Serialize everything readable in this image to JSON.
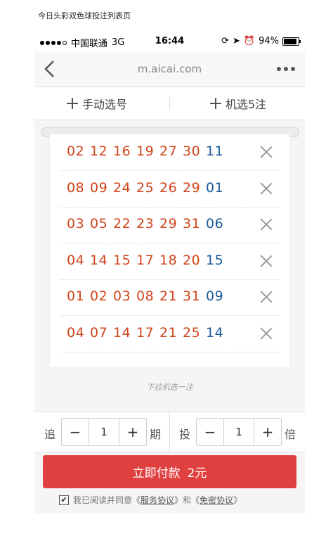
{
  "caption": "今日头彩双色球投注列表页",
  "statusbar": {
    "carrier": "中国联通",
    "network": "3G",
    "time": "16:44",
    "battery": "94%"
  },
  "navbar": {
    "url": "m.aicai.com"
  },
  "actions": {
    "manual": "手动选号",
    "random": "机选5注"
  },
  "tickets": [
    {
      "red": [
        "02",
        "12",
        "16",
        "19",
        "27",
        "30"
      ],
      "blue": "11"
    },
    {
      "red": [
        "08",
        "09",
        "24",
        "25",
        "26",
        "29"
      ],
      "blue": "01"
    },
    {
      "red": [
        "03",
        "05",
        "22",
        "23",
        "29",
        "31"
      ],
      "blue": "06"
    },
    {
      "red": [
        "04",
        "14",
        "15",
        "17",
        "18",
        "20"
      ],
      "blue": "15"
    },
    {
      "red": [
        "01",
        "02",
        "03",
        "08",
        "21",
        "31"
      ],
      "blue": "09"
    },
    {
      "red": [
        "04",
        "07",
        "14",
        "17",
        "21",
        "25"
      ],
      "blue": "14"
    }
  ],
  "hint": "下拉机选一注",
  "multiplier": {
    "chase_label": "追",
    "chase_value": "1",
    "period_label": "期",
    "bet_label": "投",
    "bet_value": "1",
    "times_label": "倍",
    "minus": "−",
    "plus": "+"
  },
  "pay": {
    "label": "立即付款",
    "amount": "2元"
  },
  "agreement": {
    "prefix": "我已阅读并同意《",
    "service": "服务协议",
    "mid": "》和《",
    "privacy": "免密协议",
    "suffix": "》",
    "checked": "✔"
  },
  "colors": {
    "red_ball": "#d0451b",
    "blue_ball": "#1a5a9a",
    "pay_button": "#e04040"
  }
}
